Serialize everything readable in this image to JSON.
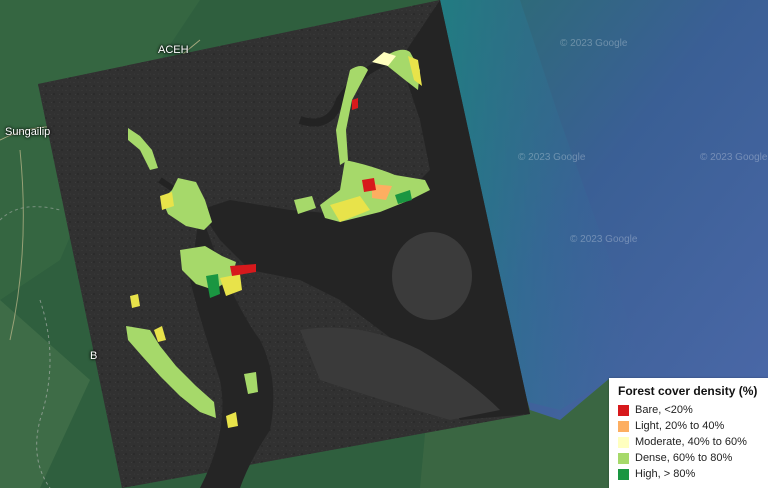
{
  "map": {
    "place_labels": {
      "aceh": "ACEH",
      "sungai": "Sungailip",
      "partial_b": "B"
    },
    "watermarks": [
      "© 2023 Google",
      "© 2023 Google",
      "© 2023 Google",
      "© 2023 Google"
    ]
  },
  "legend": {
    "title": "Forest cover density (%)",
    "items": [
      {
        "label": "Bare, <20%",
        "color": "#d7191c"
      },
      {
        "label": "Light, 20% to 40%",
        "color": "#fdae61"
      },
      {
        "label": "Moderate, 40% to 60%",
        "color": "#ffffbf"
      },
      {
        "label": "Dense, 60% to 80%",
        "color": "#a6d96a"
      },
      {
        "label": "High, > 80%",
        "color": "#1a9641"
      }
    ]
  },
  "colors": {
    "land_green": "#2f5f3e",
    "sea_deep": "#4b68a8",
    "sea_teal": "#2e8a8f",
    "sar_dark": "#2d2d2d",
    "sar_water": "#262626"
  }
}
